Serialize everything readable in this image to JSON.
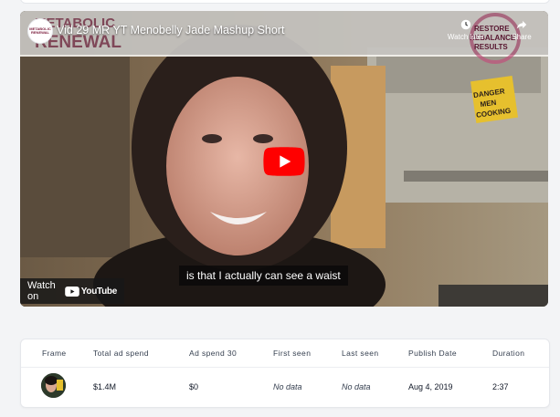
{
  "video": {
    "title": "Vid 29 MR YT Menobelly Jade Mashup Short",
    "channel_avatar_text": "METABOLIC RENEWAL",
    "overlay_brand_text": "METABOLIC RENEWAL",
    "watch_later_label": "Watch later",
    "share_label": "Share",
    "caption": "is that I actually can see a waist",
    "watch_on_label": "Watch on",
    "youtube_label": "YouTube",
    "sign_text": "DANGER MEN COOKING",
    "badge_text": "RESTORE REBALANCE RESULTS"
  },
  "table": {
    "headers": [
      "Frame",
      "Total ad spend",
      "Ad spend 30",
      "First seen",
      "Last seen",
      "Publish Date",
      "Duration"
    ],
    "row": {
      "total_ad_spend": "$1.4M",
      "ad_spend_30": "$0",
      "first_seen": "No data",
      "last_seen": "No data",
      "publish_date": "Aug 4, 2019",
      "duration": "2:37"
    }
  },
  "colors": {
    "background": "#f3f4f6",
    "card": "#ffffff",
    "youtube_red": "#ff0000"
  }
}
